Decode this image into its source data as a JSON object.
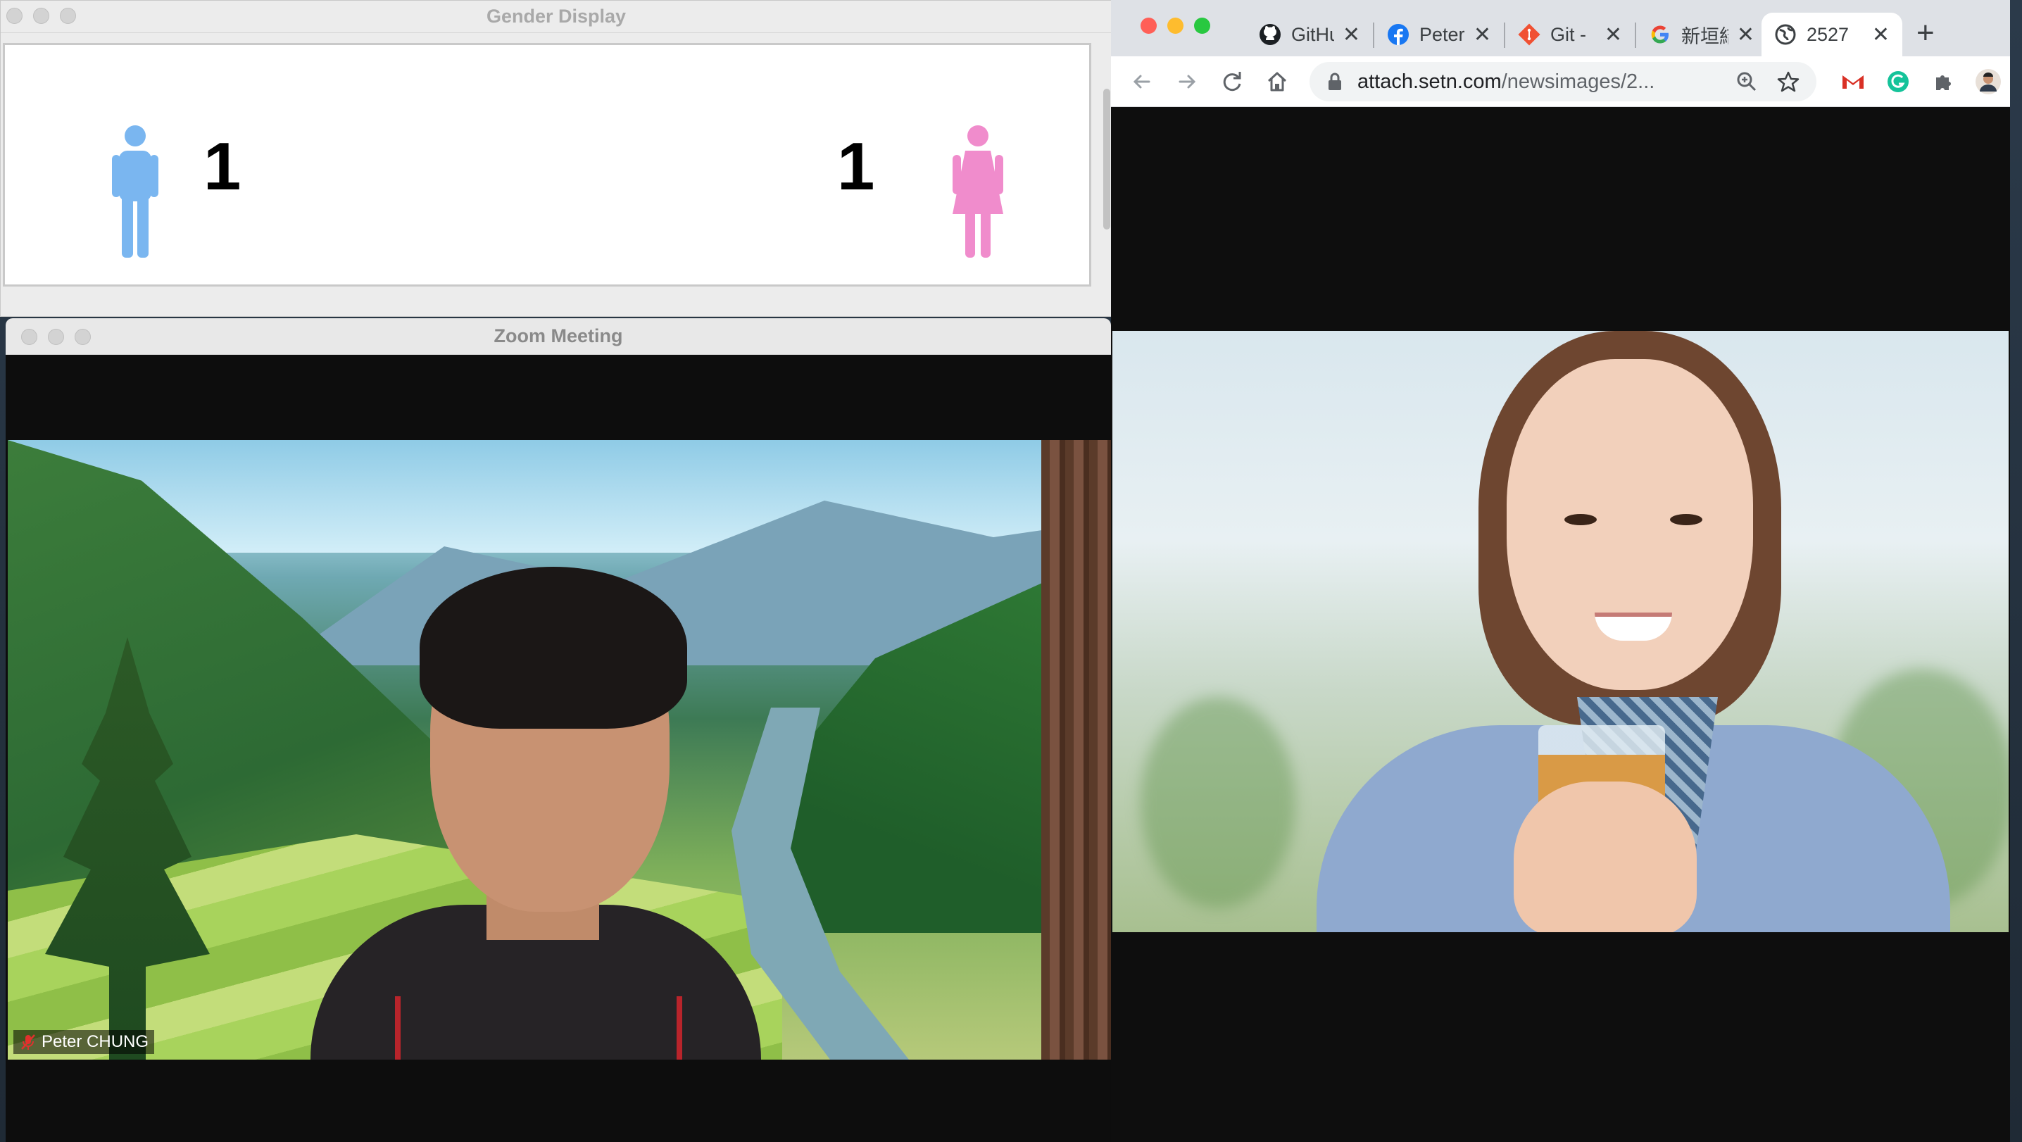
{
  "gender_window": {
    "title": "Gender Display",
    "male_count": "1",
    "female_count": "1",
    "male_color": "#7ab6f0",
    "female_color": "#f08ccc"
  },
  "zoom_window": {
    "title": "Zoom Meeting",
    "participant_name": "Peter CHUNG"
  },
  "browser": {
    "tabs": [
      {
        "label": "GitHu",
        "icon": "github-icon"
      },
      {
        "label": "Peter",
        "icon": "facebook-icon"
      },
      {
        "label": "Git -",
        "icon": "git-icon"
      },
      {
        "label": "新垣結",
        "icon": "google-icon"
      },
      {
        "label": "2527",
        "icon": "globe-icon",
        "active": true
      }
    ],
    "new_tab_label": "+",
    "url_host": "attach.setn.com",
    "url_path": "/newsimages/2..."
  },
  "colors": {
    "traffic_red": "#ff5f57",
    "traffic_yellow": "#febc2e",
    "traffic_green": "#28c840"
  }
}
